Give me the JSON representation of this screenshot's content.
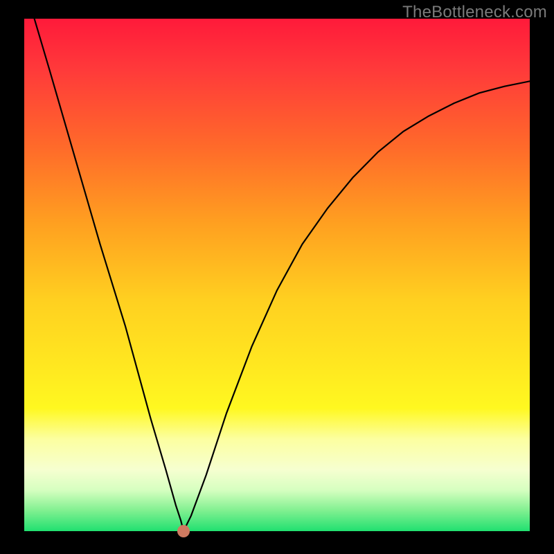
{
  "watermark": "TheBottleneck.com",
  "chart_data": {
    "type": "line",
    "title": "",
    "xlabel": "",
    "ylabel": "",
    "xlim": [
      0,
      1
    ],
    "ylim": [
      0,
      1
    ],
    "series": [
      {
        "name": "curve",
        "x": [
          0.02,
          0.05,
          0.1,
          0.15,
          0.2,
          0.25,
          0.28,
          0.3,
          0.31,
          0.315,
          0.33,
          0.36,
          0.4,
          0.45,
          0.5,
          0.55,
          0.6,
          0.65,
          0.7,
          0.75,
          0.8,
          0.85,
          0.9,
          0.95,
          1.0
        ],
        "y": [
          1.0,
          0.9,
          0.73,
          0.56,
          0.4,
          0.22,
          0.12,
          0.05,
          0.02,
          0.0,
          0.03,
          0.11,
          0.23,
          0.36,
          0.47,
          0.56,
          0.63,
          0.69,
          0.74,
          0.78,
          0.81,
          0.835,
          0.855,
          0.868,
          0.878
        ]
      }
    ],
    "marker": {
      "x": 0.315,
      "y": 0.0
    },
    "grid": false,
    "legend": false
  },
  "colors": {
    "curve": "#000000",
    "marker": "#cf7a60",
    "frame_bg_top": "#ff1a3a",
    "frame_bg_bottom": "#20e070",
    "page_bg": "#000000",
    "watermark": "#7a7a7a"
  }
}
